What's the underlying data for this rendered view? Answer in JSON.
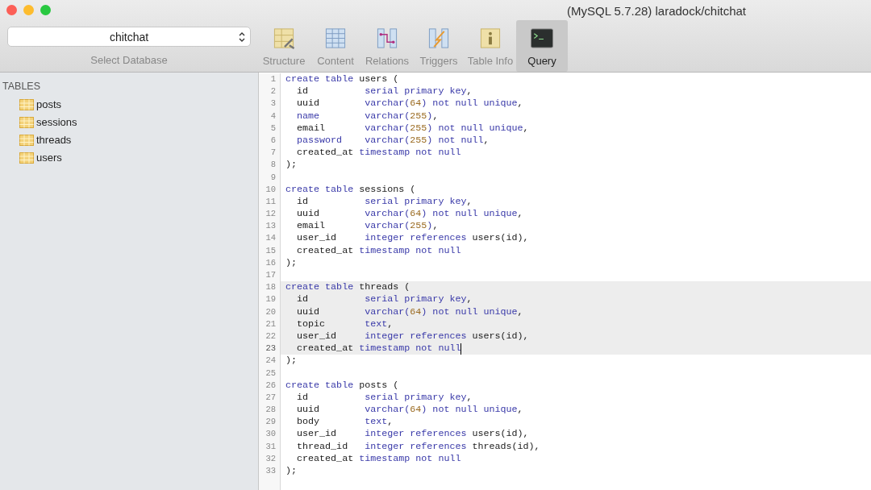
{
  "window": {
    "title": "(MySQL 5.7.28) laradock/chitchat"
  },
  "database_selector": {
    "value": "chitchat",
    "label": "Select Database"
  },
  "toolbar": [
    {
      "label": "Structure",
      "kind": "structure",
      "selected": false
    },
    {
      "label": "Content",
      "kind": "content",
      "selected": false
    },
    {
      "label": "Relations",
      "kind": "relations",
      "selected": false
    },
    {
      "label": "Triggers",
      "kind": "triggers",
      "selected": false
    },
    {
      "label": "Table Info",
      "kind": "info",
      "selected": false
    },
    {
      "label": "Query",
      "kind": "query",
      "selected": true
    }
  ],
  "sidebar": {
    "heading": "TABLES",
    "items": [
      {
        "label": "posts",
        "selected": false
      },
      {
        "label": "sessions",
        "selected": false
      },
      {
        "label": "threads",
        "selected": false
      },
      {
        "label": "users",
        "selected": false
      }
    ]
  },
  "editor": {
    "lines": [
      {
        "no": "1",
        "highlighted": false,
        "cursor": false,
        "tokens": [
          {
            "text": "create table",
            "kind": "kw"
          },
          {
            "text": " users (",
            "kind": "plain"
          }
        ]
      },
      {
        "no": "2",
        "highlighted": false,
        "cursor": false,
        "tokens": [
          {
            "text": "  id          ",
            "kind": "plain"
          },
          {
            "text": "serial primary key",
            "kind": "kw"
          },
          {
            "text": ",",
            "kind": "plain"
          }
        ]
      },
      {
        "no": "3",
        "highlighted": false,
        "cursor": false,
        "tokens": [
          {
            "text": "  uuid        ",
            "kind": "plain"
          },
          {
            "text": "varchar(",
            "kind": "kw"
          },
          {
            "text": "64",
            "kind": "num"
          },
          {
            "text": ") not null unique",
            "kind": "kw"
          },
          {
            "text": ",",
            "kind": "plain"
          }
        ]
      },
      {
        "no": "4",
        "highlighted": false,
        "cursor": false,
        "tokens": [
          {
            "text": "  name        varchar(",
            "kind": "kw"
          },
          {
            "text": "255",
            "kind": "num"
          },
          {
            "text": ")",
            "kind": "kw"
          },
          {
            "text": ",",
            "kind": "plain"
          }
        ]
      },
      {
        "no": "5",
        "highlighted": false,
        "cursor": false,
        "tokens": [
          {
            "text": "  email       ",
            "kind": "plain"
          },
          {
            "text": "varchar(",
            "kind": "kw"
          },
          {
            "text": "255",
            "kind": "num"
          },
          {
            "text": ") not null unique",
            "kind": "kw"
          },
          {
            "text": ",",
            "kind": "plain"
          }
        ]
      },
      {
        "no": "6",
        "highlighted": false,
        "cursor": false,
        "tokens": [
          {
            "text": "  password    varchar(",
            "kind": "kw"
          },
          {
            "text": "255",
            "kind": "num"
          },
          {
            "text": ") not null",
            "kind": "kw"
          },
          {
            "text": ",",
            "kind": "plain"
          }
        ]
      },
      {
        "no": "7",
        "highlighted": false,
        "cursor": false,
        "tokens": [
          {
            "text": "  created_at ",
            "kind": "plain"
          },
          {
            "text": "timestamp not null",
            "kind": "kw"
          }
        ]
      },
      {
        "no": "8",
        "highlighted": false,
        "cursor": false,
        "tokens": [
          {
            "text": ");",
            "kind": "plain"
          }
        ]
      },
      {
        "no": "9",
        "highlighted": false,
        "cursor": false
      },
      {
        "no": "10",
        "highlighted": false,
        "cursor": false,
        "tokens": [
          {
            "text": "create table",
            "kind": "kw"
          },
          {
            "text": " sessions (",
            "kind": "plain"
          }
        ]
      },
      {
        "no": "11",
        "highlighted": false,
        "cursor": false,
        "tokens": [
          {
            "text": "  id          ",
            "kind": "plain"
          },
          {
            "text": "serial primary key",
            "kind": "kw"
          },
          {
            "text": ",",
            "kind": "plain"
          }
        ]
      },
      {
        "no": "12",
        "highlighted": false,
        "cursor": false,
        "tokens": [
          {
            "text": "  uuid        ",
            "kind": "plain"
          },
          {
            "text": "varchar(",
            "kind": "kw"
          },
          {
            "text": "64",
            "kind": "num"
          },
          {
            "text": ") not null unique",
            "kind": "kw"
          },
          {
            "text": ",",
            "kind": "plain"
          }
        ]
      },
      {
        "no": "13",
        "highlighted": false,
        "cursor": false,
        "tokens": [
          {
            "text": "  email       ",
            "kind": "plain"
          },
          {
            "text": "varchar(",
            "kind": "kw"
          },
          {
            "text": "255",
            "kind": "num"
          },
          {
            "text": ")",
            "kind": "kw"
          },
          {
            "text": ",",
            "kind": "plain"
          }
        ]
      },
      {
        "no": "14",
        "highlighted": false,
        "cursor": false,
        "tokens": [
          {
            "text": "  user_id     ",
            "kind": "plain"
          },
          {
            "text": "integer references",
            "kind": "kw"
          },
          {
            "text": " users(id),",
            "kind": "plain"
          }
        ]
      },
      {
        "no": "15",
        "highlighted": false,
        "cursor": false,
        "tokens": [
          {
            "text": "  created_at ",
            "kind": "plain"
          },
          {
            "text": "timestamp not null",
            "kind": "kw"
          }
        ]
      },
      {
        "no": "16",
        "highlighted": false,
        "cursor": false,
        "tokens": [
          {
            "text": ");",
            "kind": "plain"
          }
        ]
      },
      {
        "no": "17",
        "highlighted": false,
        "cursor": false
      },
      {
        "no": "18",
        "highlighted": true,
        "cursor": false,
        "tokens": [
          {
            "text": "create table",
            "kind": "kw"
          },
          {
            "text": " threads (",
            "kind": "plain"
          }
        ]
      },
      {
        "no": "19",
        "highlighted": true,
        "cursor": false,
        "tokens": [
          {
            "text": "  id          ",
            "kind": "plain"
          },
          {
            "text": "serial primary key",
            "kind": "kw"
          },
          {
            "text": ",",
            "kind": "plain"
          }
        ]
      },
      {
        "no": "20",
        "highlighted": true,
        "cursor": false,
        "tokens": [
          {
            "text": "  uuid        ",
            "kind": "plain"
          },
          {
            "text": "varchar(",
            "kind": "kw"
          },
          {
            "text": "64",
            "kind": "num"
          },
          {
            "text": ") not null unique",
            "kind": "kw"
          },
          {
            "text": ",",
            "kind": "plain"
          }
        ]
      },
      {
        "no": "21",
        "highlighted": true,
        "cursor": false,
        "tokens": [
          {
            "text": "  topic       ",
            "kind": "plain"
          },
          {
            "text": "text",
            "kind": "kw"
          },
          {
            "text": ",",
            "kind": "plain"
          }
        ]
      },
      {
        "no": "22",
        "highlighted": true,
        "cursor": false,
        "tokens": [
          {
            "text": "  user_id     ",
            "kind": "plain"
          },
          {
            "text": "integer references",
            "kind": "kw"
          },
          {
            "text": " users(id),",
            "kind": "plain"
          }
        ]
      },
      {
        "no": "23",
        "highlighted": true,
        "cursor": true,
        "tokens": [
          {
            "text": "  created_at ",
            "kind": "plain"
          },
          {
            "text": "timestamp not null",
            "kind": "kw"
          }
        ]
      },
      {
        "no": "24",
        "highlighted": false,
        "cursor": false,
        "tokens": [
          {
            "text": ");",
            "kind": "plain"
          }
        ]
      },
      {
        "no": "25",
        "highlighted": false,
        "cursor": false
      },
      {
        "no": "26",
        "highlighted": false,
        "cursor": false,
        "tokens": [
          {
            "text": "create table",
            "kind": "kw"
          },
          {
            "text": " posts (",
            "kind": "plain"
          }
        ]
      },
      {
        "no": "27",
        "highlighted": false,
        "cursor": false,
        "tokens": [
          {
            "text": "  id          ",
            "kind": "plain"
          },
          {
            "text": "serial primary key",
            "kind": "kw"
          },
          {
            "text": ",",
            "kind": "plain"
          }
        ]
      },
      {
        "no": "28",
        "highlighted": false,
        "cursor": false,
        "tokens": [
          {
            "text": "  uuid        ",
            "kind": "plain"
          },
          {
            "text": "varchar(",
            "kind": "kw"
          },
          {
            "text": "64",
            "kind": "num"
          },
          {
            "text": ") not null unique",
            "kind": "kw"
          },
          {
            "text": ",",
            "kind": "plain"
          }
        ]
      },
      {
        "no": "29",
        "highlighted": false,
        "cursor": false,
        "tokens": [
          {
            "text": "  body        ",
            "kind": "plain"
          },
          {
            "text": "text",
            "kind": "kw"
          },
          {
            "text": ",",
            "kind": "plain"
          }
        ]
      },
      {
        "no": "30",
        "highlighted": false,
        "cursor": false,
        "tokens": [
          {
            "text": "  user_id     ",
            "kind": "plain"
          },
          {
            "text": "integer references",
            "kind": "kw"
          },
          {
            "text": " users(id),",
            "kind": "plain"
          }
        ]
      },
      {
        "no": "31",
        "highlighted": false,
        "cursor": false,
        "tokens": [
          {
            "text": "  thread_id   ",
            "kind": "plain"
          },
          {
            "text": "integer references",
            "kind": "kw"
          },
          {
            "text": " threads(id),",
            "kind": "plain"
          }
        ]
      },
      {
        "no": "32",
        "highlighted": false,
        "cursor": false,
        "tokens": [
          {
            "text": "  created_at ",
            "kind": "plain"
          },
          {
            "text": "timestamp not null",
            "kind": "kw"
          }
        ]
      },
      {
        "no": "33",
        "highlighted": false,
        "cursor": false,
        "tokens": [
          {
            "text": ");",
            "kind": "plain"
          }
        ]
      }
    ]
  }
}
